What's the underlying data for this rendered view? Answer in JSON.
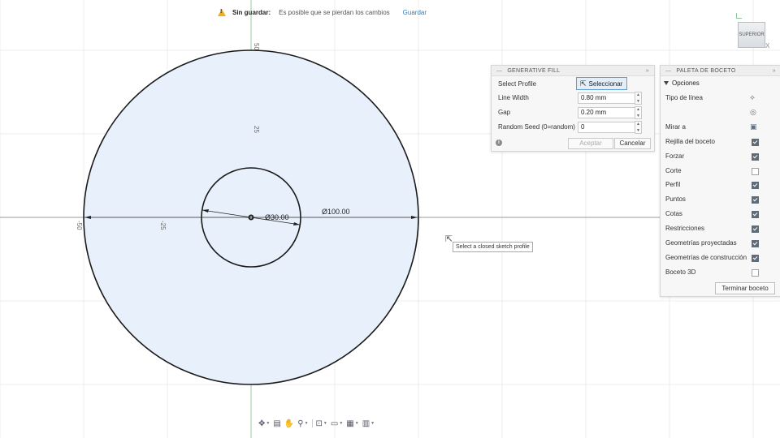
{
  "savebar": {
    "title": "Sin guardar:",
    "message": "Es posible que se pierdan los cambios",
    "save_link": "Guardar"
  },
  "viewcube": {
    "face": "SUPERIOR",
    "axis_x": "X"
  },
  "sketch": {
    "axis_labels": {
      "top_50": "50",
      "top_25": "25",
      "left_50": "-50",
      "left_25": "-25"
    },
    "dim_inner": "Ø30.00",
    "dim_outer": "Ø100.00",
    "fill_color": "#e8f1fb",
    "stroke_color": "#1a1a1a"
  },
  "generative_fill": {
    "header": "GENERATIVE FILL",
    "select_profile_label": "Select Profile",
    "select_button": "Seleccionar",
    "line_width_label": "Line Width",
    "line_width_value": "0.80 mm",
    "gap_label": "Gap",
    "gap_value": "0.20 mm",
    "seed_label": "Random Seed (0=random)",
    "seed_value": "0",
    "accept_button": "Aceptar",
    "cancel_button": "Cancelar"
  },
  "palette": {
    "header": "PALETA DE BOCETO",
    "section": "Opciones",
    "items": [
      {
        "label": "Tipo de línea",
        "control": "icon",
        "icon": "linetype-icon"
      },
      {
        "label": "",
        "control": "icon",
        "icon": "globe-icon"
      },
      {
        "label": "Mirar a",
        "control": "icon",
        "icon": "look-at-icon"
      },
      {
        "label": "Rejilla del boceto",
        "control": "check",
        "checked": true
      },
      {
        "label": "Forzar",
        "control": "check",
        "checked": true
      },
      {
        "label": "Corte",
        "control": "check",
        "checked": false
      },
      {
        "label": "Perfil",
        "control": "check",
        "checked": true
      },
      {
        "label": "Puntos",
        "control": "check",
        "checked": true
      },
      {
        "label": "Cotas",
        "control": "check",
        "checked": true
      },
      {
        "label": "Restricciones",
        "control": "check",
        "checked": true
      },
      {
        "label": "Geometrías proyectadas",
        "control": "check",
        "checked": true
      },
      {
        "label": "Geometrías de construcción",
        "control": "check",
        "checked": true
      },
      {
        "label": "Boceto 3D",
        "control": "check",
        "checked": false
      }
    ],
    "finish_button": "Terminar boceto"
  },
  "tooltip": "Select a closed sketch profile"
}
